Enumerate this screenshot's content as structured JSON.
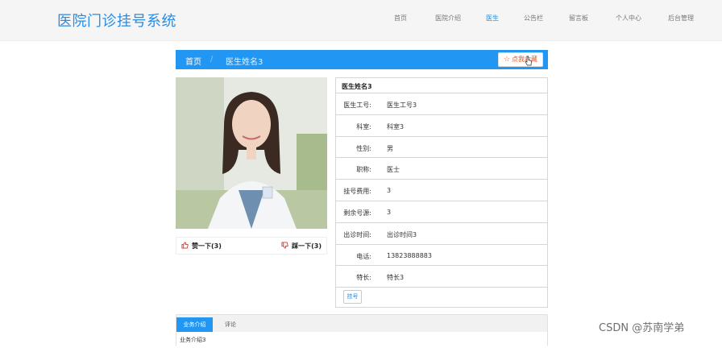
{
  "header": {
    "site_title": "医院门诊挂号系统",
    "nav": [
      {
        "label": "首页",
        "active": false
      },
      {
        "label": "医院介绍",
        "active": false
      },
      {
        "label": "医生",
        "active": true
      },
      {
        "label": "公告栏",
        "active": false
      },
      {
        "label": "留言板",
        "active": false
      },
      {
        "label": "个人中心",
        "active": false
      },
      {
        "label": "后台管理",
        "active": false
      }
    ],
    "accent_color": "#2196f3"
  },
  "breadcrumb": {
    "home": "首页",
    "separator": "/",
    "current": "医生姓名3",
    "favorite_label": "点我收藏",
    "favorite_icon": "star-outline-icon"
  },
  "doctor": {
    "photo_alt": "doctor-photo",
    "like_label": "赞一下(3)",
    "dislike_label": "踩一下(3)",
    "like_icon": "thumbs-up-icon",
    "dislike_icon": "thumbs-down-icon",
    "title": "医生姓名3",
    "fields": [
      {
        "key": "医生工号:",
        "value": "医生工号3"
      },
      {
        "key": "科室:",
        "value": "科室3"
      },
      {
        "key": "性别:",
        "value": "男"
      },
      {
        "key": "职称:",
        "value": "医士"
      },
      {
        "key": "挂号费用:",
        "value": "3"
      },
      {
        "key": "剩余号源:",
        "value": "3"
      },
      {
        "key": "出诊时间:",
        "value": "出诊时间3"
      },
      {
        "key": "电话:",
        "value": "13823888883"
      },
      {
        "key": "特长:",
        "value": "特长3"
      }
    ],
    "book_label": "挂号"
  },
  "tabs": {
    "items": [
      "业务介绍",
      "评论"
    ],
    "content": "业务介绍3"
  },
  "watermark": "CSDN @苏南学弟"
}
